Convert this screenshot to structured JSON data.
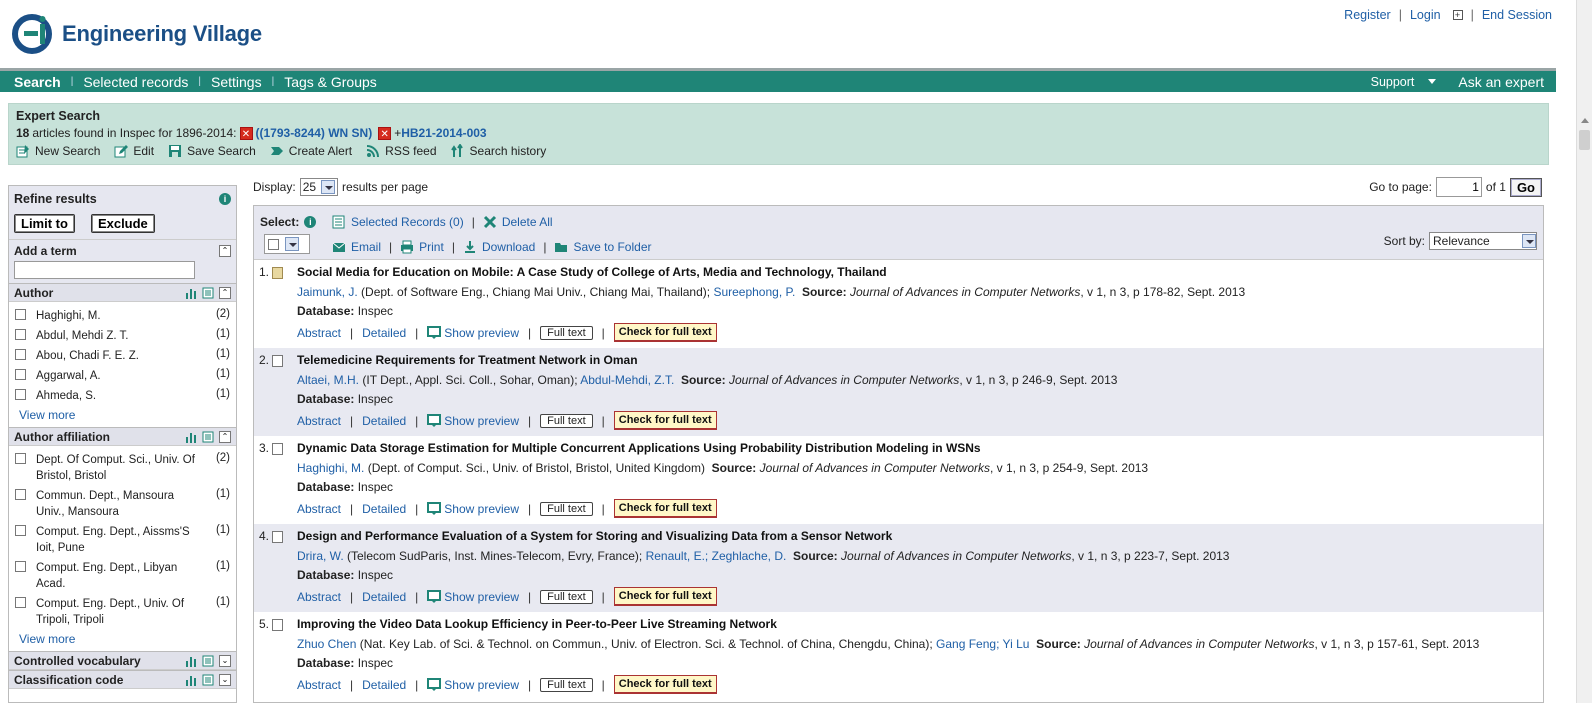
{
  "header": {
    "brand": "Engineering Village",
    "links": [
      "Register",
      "Login",
      "End Session"
    ]
  },
  "nav": {
    "items": [
      "Search",
      "Selected records",
      "Settings",
      "Tags & Groups"
    ],
    "support": "Support",
    "ask": "Ask an expert"
  },
  "search": {
    "title": "Expert Search",
    "count": "18",
    "found_text": "articles found in Inspec for 1896-2014:",
    "term1": "((1793-8244) WN SN)",
    "term2_prefix": "+",
    "term2": "HB21-2014-003",
    "actions": [
      "New Search",
      "Edit",
      "Save Search",
      "Create Alert",
      "RSS feed",
      "Search history"
    ]
  },
  "refine": {
    "title": "Refine results",
    "limit": "Limit to",
    "exclude": "Exclude",
    "add_term": "Add a term",
    "add_term_value": ""
  },
  "facets": {
    "author": {
      "title": "Author",
      "items": [
        {
          "label": "Haghighi, M.",
          "count": "(2)"
        },
        {
          "label": "Abdul, Mehdi Z. T.",
          "count": "(1)"
        },
        {
          "label": "Abou, Chadi F. E. Z.",
          "count": "(1)"
        },
        {
          "label": "Aggarwal, A.",
          "count": "(1)"
        },
        {
          "label": "Ahmeda, S.",
          "count": "(1)"
        }
      ],
      "view_more": "View more"
    },
    "affiliation": {
      "title": "Author affiliation",
      "items": [
        {
          "label": "Dept. Of Comput. Sci., Univ. Of Bristol, Bristol",
          "count": "(2)"
        },
        {
          "label": "Commun. Dept., Mansoura Univ., Mansoura",
          "count": "(1)"
        },
        {
          "label": "Comput. Eng. Dept., Aissms'S Ioit, Pune",
          "count": "(1)"
        },
        {
          "label": "Comput. Eng. Dept., Libyan Acad.",
          "count": "(1)"
        },
        {
          "label": "Comput. Eng. Dept., Univ. Of Tripoli, Tripoli",
          "count": "(1)"
        }
      ],
      "view_more": "View more"
    },
    "controlled": {
      "title": "Controlled vocabulary"
    },
    "classification": {
      "title": "Classification code"
    }
  },
  "display": {
    "label": "Display:",
    "value": "25",
    "suffix": "results per page",
    "goto_label": "Go to page:",
    "page": "1",
    "of": "of 1",
    "go": "Go"
  },
  "toolbar": {
    "select": "Select:",
    "selected_records": "Selected Records (0)",
    "delete_all": "Delete All",
    "email": "Email",
    "print": "Print",
    "download": "Download",
    "save_folder": "Save to Folder",
    "sort_label": "Sort by:",
    "sort_value": "Relevance"
  },
  "record_labels": {
    "source": "Source:",
    "database": "Database:",
    "abstract": "Abstract",
    "detailed": "Detailed",
    "show_preview": "Show preview",
    "full_text": "Full text",
    "check_full": "Check for full text"
  },
  "records": [
    {
      "num": "1.",
      "title": "Social Media for Education on Mobile: A Case Study of College of Arts, Media and Technology, Thailand",
      "a1": "Jaimunk, J.",
      "a1_aff": "(Dept. of Software Eng., Chiang Mai Univ., Chiang Mai, Thailand);",
      "a2": "Sureephong, P.",
      "journal": "Journal of Advances in Computer Networks",
      "details": ", v 1, n 3, p 178-82, Sept. 2013",
      "db": "Inspec"
    },
    {
      "num": "2.",
      "title": "Telemedicine Requirements for Treatment Network in Oman",
      "a1": "Altaei, M.H.",
      "a1_aff": "(IT Dept., Appl. Sci. Coll., Sohar, Oman);",
      "a2": "Abdul-Mehdi, Z.T.",
      "journal": "Journal of Advances in Computer Networks",
      "details": ", v 1, n 3, p 246-9, Sept. 2013",
      "db": "Inspec"
    },
    {
      "num": "3.",
      "title": "Dynamic Data Storage Estimation for Multiple Concurrent Applications Using Probability Distribution Modeling in WSNs",
      "a1": "Haghighi, M.",
      "a1_aff": "(Dept. of Comput. Sci., Univ. of Bristol, Bristol, United Kingdom)",
      "a2": "",
      "journal": "Journal of Advances in Computer Networks",
      "details": ", v 1, n 3, p 254-9, Sept. 2013",
      "db": "Inspec"
    },
    {
      "num": "4.",
      "title": "Design and Performance Evaluation of a System for Storing and Visualizing Data from a Sensor Network",
      "a1": "Drira, W.",
      "a1_aff": "(Telecom SudParis, Inst. Mines-Telecom, Evry, France);",
      "a2": "Renault, E.;",
      "a3": "Zeghlache, D.",
      "journal": "Journal of Advances in Computer Networks",
      "details": ", v 1, n 3, p 223-7, Sept. 2013",
      "db": "Inspec"
    },
    {
      "num": "5.",
      "title": "Improving the Video Data Lookup Efficiency in Peer-to-Peer Live Streaming Network",
      "a1": "Zhuo Chen",
      "a1_aff": "(Nat. Key Lab. of Sci. & Technol. on Commun., Univ. of Electron. Sci. & Technol. of China, Chengdu, China);",
      "a2": "Gang Feng;",
      "a3": "Yi Lu",
      "journal": "Journal of Advances in Computer Networks",
      "details": ", v 1, n 3, p 157-61, Sept. 2013",
      "db": "Inspec"
    }
  ],
  "colors": {
    "nav": "#1f8577",
    "searchbox": "#c7e2d9",
    "link": "#1f5fa6"
  }
}
